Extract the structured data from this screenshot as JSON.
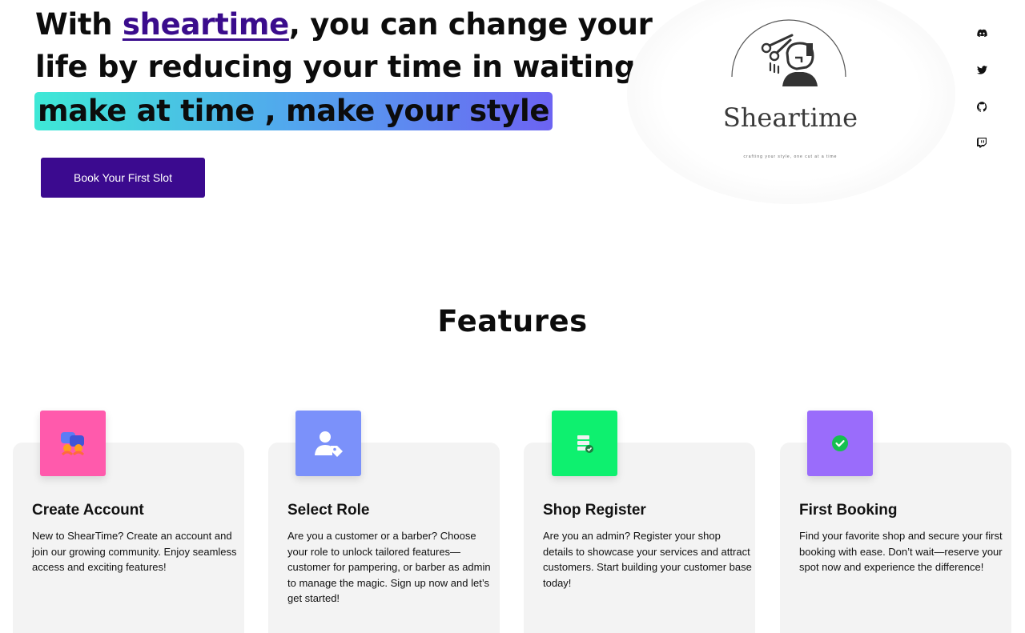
{
  "hero": {
    "line1_prefix": "With ",
    "brand": "sheartime",
    "line1_suffix": ", you can change your",
    "line2": "life by reducing your time in waiting",
    "highlight": "make at time , make your style",
    "cta_label": "Book Your First Slot"
  },
  "logo": {
    "wordmark": "Sheartime",
    "tagline": "crafting your style, one cut at a time",
    "icon": "barber-scissors-icon"
  },
  "social": [
    {
      "icon": "discord-icon"
    },
    {
      "icon": "twitter-icon"
    },
    {
      "icon": "github-icon"
    },
    {
      "icon": "twitch-icon"
    }
  ],
  "features": {
    "title": "Features",
    "items": [
      {
        "title": "Create Account",
        "description": "New to ShearTime? Create an account and join our growing community. Enjoy seamless access and exciting features!",
        "icon": "users-icon",
        "color": "#ff5aac"
      },
      {
        "title": "Select Role",
        "description": "Are you a customer or a barber? Choose your role to unlock tailored features—customer for pampering, or barber as admin to manage the magic. Sign up now and let’s get started!",
        "icon": "user-tag-icon",
        "color": "#7b91fa"
      },
      {
        "title": "Shop Register",
        "description": "Are you an admin? Register your shop details to showcase your services and attract customers. Start building your customer base today!",
        "icon": "server-check-icon",
        "color": "#0ef06f"
      },
      {
        "title": "First Booking",
        "description": "Find your favorite shop and secure your first booking with ease. Don’t wait—reserve your spot now and experience the difference!",
        "icon": "check-circle-icon",
        "color": "#9a6cfb"
      }
    ]
  }
}
